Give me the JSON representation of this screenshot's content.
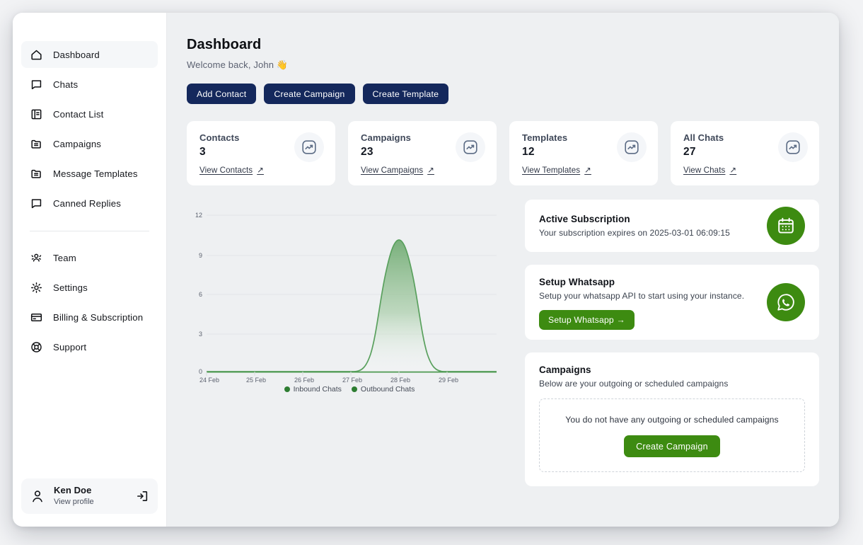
{
  "sidebar": {
    "items": [
      {
        "label": "Dashboard",
        "icon": "home-icon",
        "active": true
      },
      {
        "label": "Chats",
        "icon": "chat-bubble-icon",
        "active": false
      },
      {
        "label": "Contact List",
        "icon": "contact-book-icon",
        "active": false
      },
      {
        "label": "Campaigns",
        "icon": "folder-icon",
        "active": false
      },
      {
        "label": "Message Templates",
        "icon": "folder-icon",
        "active": false
      },
      {
        "label": "Canned Replies",
        "icon": "chat-bubble-icon",
        "active": false
      }
    ],
    "items_secondary": [
      {
        "label": "Team",
        "icon": "users-icon"
      },
      {
        "label": "Settings",
        "icon": "gear-icon"
      },
      {
        "label": "Billing & Subscription",
        "icon": "credit-card-icon"
      },
      {
        "label": "Support",
        "icon": "lifebuoy-icon"
      }
    ],
    "profile": {
      "name": "Ken Doe",
      "subtitle": "View profile",
      "avatar_icon": "user-avatar-icon",
      "logout_icon": "logout-icon"
    }
  },
  "header": {
    "title": "Dashboard",
    "welcome": "Welcome back, John 👋",
    "actions": [
      {
        "label": "Add Contact"
      },
      {
        "label": "Create Campaign"
      },
      {
        "label": "Create Template"
      }
    ]
  },
  "stats": [
    {
      "title": "Contacts",
      "value": "3",
      "link": "View Contacts",
      "arrow": "↗",
      "icon": "trending-up-icon"
    },
    {
      "title": "Campaigns",
      "value": "23",
      "link": "View Campaigns",
      "arrow": "↗",
      "icon": "trending-up-icon"
    },
    {
      "title": "Templates",
      "value": "12",
      "link": "View Templates",
      "arrow": "↗",
      "icon": "trending-up-icon"
    },
    {
      "title": "All Chats",
      "value": "27",
      "link": "View Chats",
      "arrow": "↗",
      "icon": "trending-up-icon"
    }
  ],
  "chart_data": {
    "type": "area",
    "title": "",
    "xlabel": "",
    "ylabel": "",
    "x": [
      "24 Feb",
      "25 Feb",
      "26 Feb",
      "27 Feb",
      "28 Feb",
      "29 Feb"
    ],
    "categories": [
      "24 Feb",
      "25 Feb",
      "26 Feb",
      "27 Feb",
      "28 Feb",
      "29 Feb"
    ],
    "series": [
      {
        "name": "Inbound Chats",
        "color": "#2e7d32",
        "values": [
          0,
          0,
          0,
          0,
          0,
          0
        ]
      },
      {
        "name": "Outbound Chats",
        "color": "#5aa35e",
        "values": [
          0,
          0,
          0,
          0,
          10,
          0
        ]
      }
    ],
    "ylim": [
      0,
      12
    ],
    "yticks": [
      0,
      3,
      6,
      9,
      12
    ],
    "ytick_labels": [
      "0",
      "3",
      "6",
      "9",
      "12"
    ],
    "grid": true,
    "legend_position": "bottom",
    "legend": [
      {
        "label": "Inbound Chats",
        "color": "#2e7d32"
      },
      {
        "label": "Outbound Chats",
        "color": "#2e7d32"
      }
    ],
    "peak": {
      "x": "28 Feb",
      "y": 10
    }
  },
  "subscription": {
    "title": "Active Subscription",
    "text": "Your subscription expires on 2025-03-01 06:09:15",
    "icon": "calendar-icon"
  },
  "whatsapp": {
    "title": "Setup Whatsapp",
    "text": "Setup your whatsapp API to start using your instance.",
    "button": "Setup Whatsapp →",
    "icon": "whatsapp-icon"
  },
  "campaigns": {
    "title": "Campaigns",
    "subtitle": "Below are your outgoing or scheduled campaigns",
    "empty_text": "You do not have any outgoing or scheduled campaigns",
    "button": "Create Campaign"
  },
  "colors": {
    "navy": "#14285c",
    "green": "#3d8b11",
    "chart_line": "#5aa35e",
    "page_bg": "#eef0f2",
    "sidebar_bg": "#ffffff"
  }
}
